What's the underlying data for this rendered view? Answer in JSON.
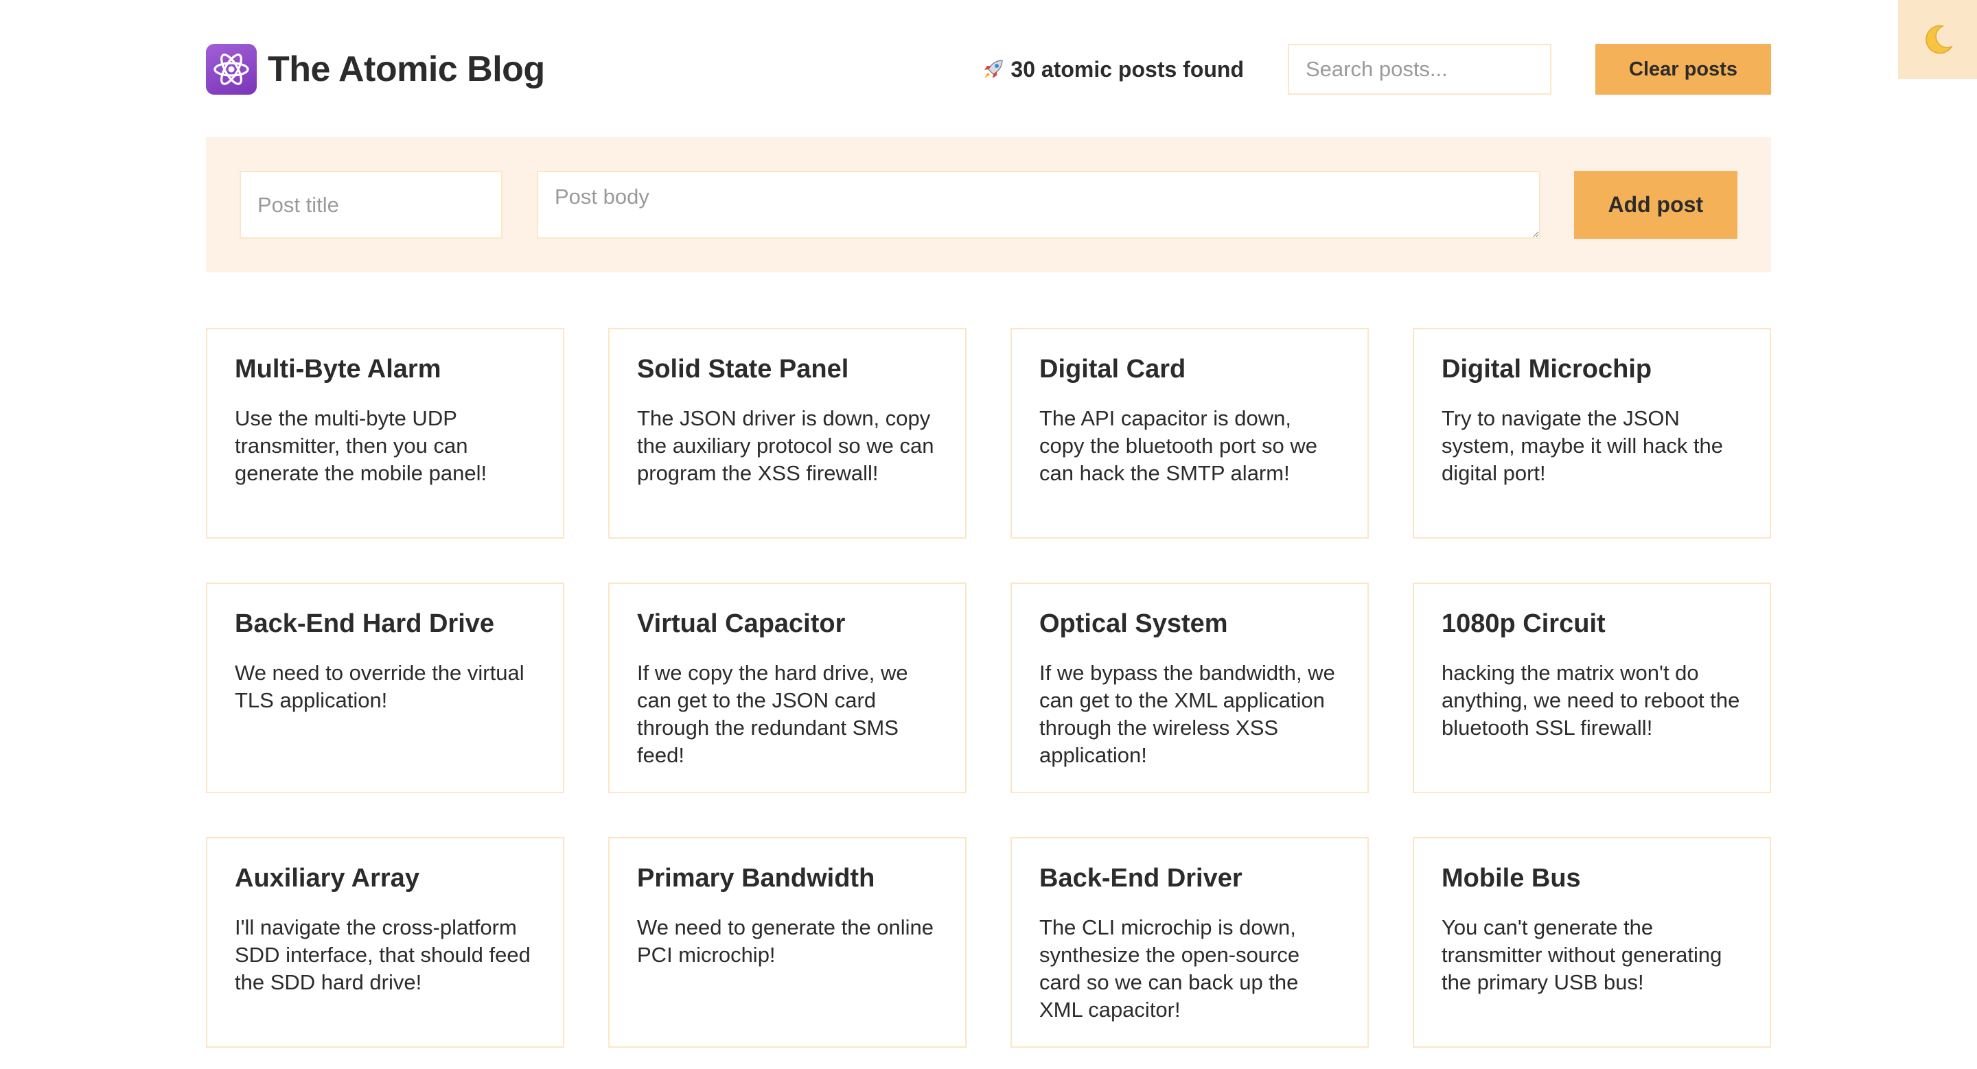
{
  "header": {
    "title": "The Atomic Blog",
    "logo_icon": "atom-icon",
    "posts_found": "30 atomic posts found",
    "posts_found_icon": "rocket-icon",
    "search": {
      "placeholder": "Search posts...",
      "value": ""
    },
    "clear_label": "Clear posts"
  },
  "theme_toggle": {
    "icon": "moon-icon"
  },
  "form": {
    "title_placeholder": "Post title",
    "body_placeholder": "Post body",
    "add_label": "Add post"
  },
  "colors": {
    "accent": "#f4b158",
    "panel": "#fdf2e5",
    "border": "#fbe7c8",
    "logo": "#8e44c8"
  },
  "posts": [
    {
      "title": "Multi-Byte Alarm",
      "body": "Use the multi-byte UDP transmitter, then you can generate the mobile panel!"
    },
    {
      "title": "Solid State Panel",
      "body": "The JSON driver is down, copy the auxiliary protocol so we can program the XSS firewall!"
    },
    {
      "title": "Digital Card",
      "body": "The API capacitor is down, copy the bluetooth port so we can hack the SMTP alarm!"
    },
    {
      "title": "Digital Microchip",
      "body": "Try to navigate the JSON system, maybe it will hack the digital port!"
    },
    {
      "title": "Back-End Hard Drive",
      "body": "We need to override the virtual TLS application!"
    },
    {
      "title": "Virtual Capacitor",
      "body": "If we copy the hard drive, we can get to the JSON card through the redundant SMS feed!"
    },
    {
      "title": "Optical System",
      "body": "If we bypass the bandwidth, we can get to the XML application through the wireless XSS application!"
    },
    {
      "title": "1080p Circuit",
      "body": "hacking the matrix won't do anything, we need to reboot the bluetooth SSL firewall!"
    },
    {
      "title": "Auxiliary Array",
      "body": "I'll navigate the cross-platform SDD interface, that should feed the SDD hard drive!"
    },
    {
      "title": "Primary Bandwidth",
      "body": "We need to generate the online PCI microchip!"
    },
    {
      "title": "Back-End Driver",
      "body": "The CLI microchip is down, synthesize the open-source card so we can back up the XML capacitor!"
    },
    {
      "title": "Mobile Bus",
      "body": "You can't generate the transmitter without generating the primary USB bus!"
    }
  ]
}
